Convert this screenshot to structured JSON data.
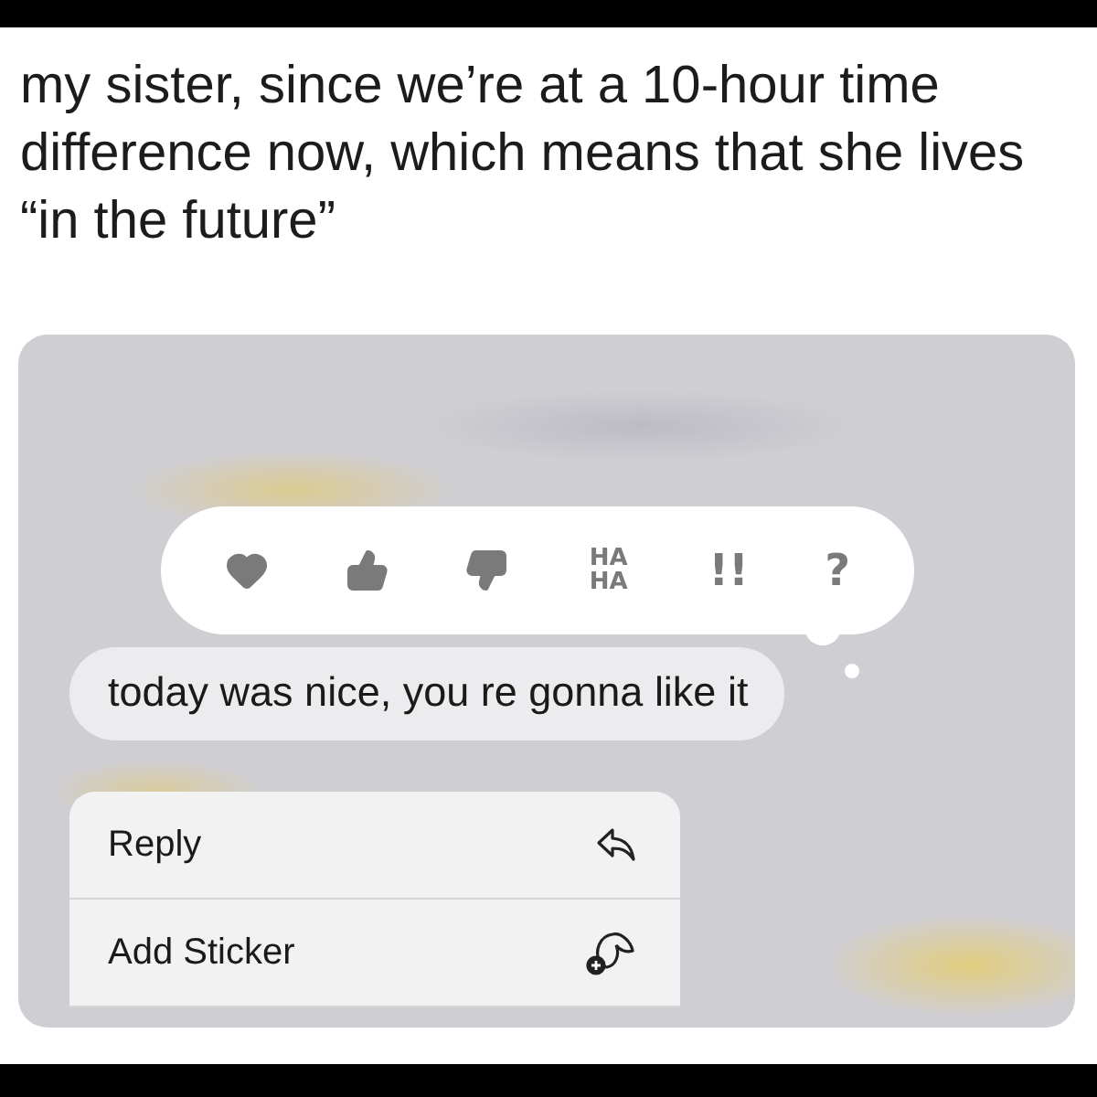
{
  "post": {
    "caption": "my sister, since we’re at a 10-hour time difference now, which means that she lives “in the future”"
  },
  "reactions": [
    {
      "kind": "heart"
    },
    {
      "kind": "thumbs-up"
    },
    {
      "kind": "thumbs-down"
    },
    {
      "kind": "text",
      "label": "HA HA"
    },
    {
      "kind": "text",
      "label": "!!"
    },
    {
      "kind": "text",
      "label": "?"
    }
  ],
  "message": {
    "text": "today was nice, you re gonna like it"
  },
  "menu": [
    {
      "label": "Reply",
      "kind": "reply"
    },
    {
      "label": "Add Sticker",
      "kind": "sticker"
    }
  ]
}
